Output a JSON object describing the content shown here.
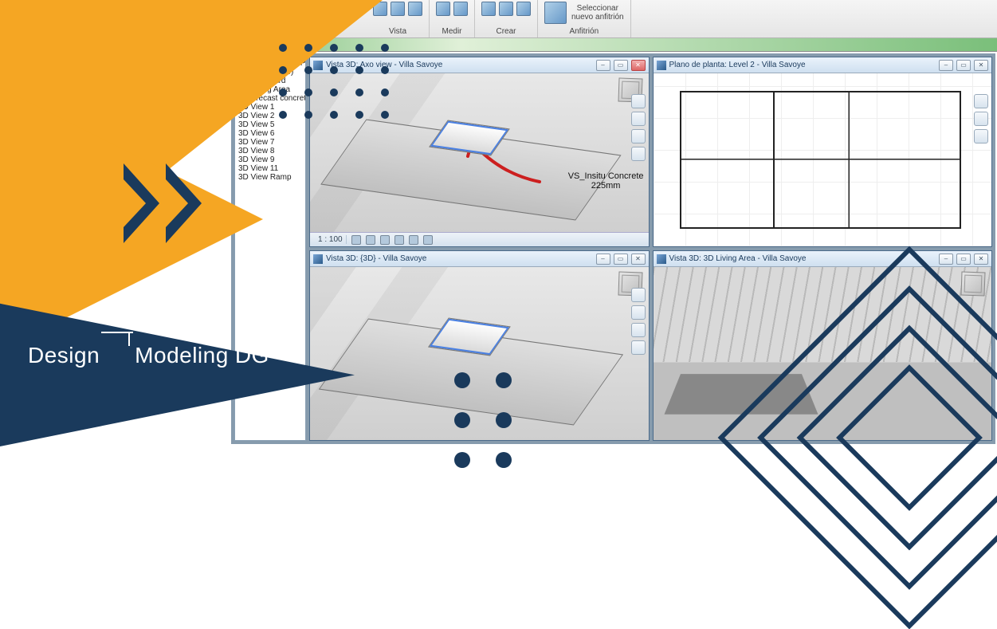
{
  "brand": {
    "logo_text_1": "Design",
    "logo_text_2": "Modeling",
    "logo_text_3": "DG"
  },
  "ribbon": {
    "panels": [
      {
        "label": "Vista"
      },
      {
        "label": "Medir"
      },
      {
        "label": "Crear"
      },
      {
        "label": "Anfitrión",
        "big_label": "Seleccionar\nnuevo anfitrión"
      }
    ]
  },
  "browser": {
    "items": [
      "de techo (Ceiling Plan)",
      "is 3D (3D View)",
      "3D Courtyard",
      "3D Living Area",
      "3D Precast concrete_navisv",
      "3D View 1",
      "3D View 2",
      "3D View 5",
      "3D View 6",
      "3D View 7",
      "3D View 8",
      "3D View 9",
      "3D View 11",
      "3D View Ramp"
    ]
  },
  "viewports": {
    "tl": {
      "title": "Vista 3D: Axo view - Villa Savoye",
      "scale": "1 : 100",
      "annotation": "VS_Insitu Concrete\n225mm"
    },
    "tr": {
      "title": "Plano de planta: Level 2 - Villa Savoye"
    },
    "bl": {
      "title": "Vista 3D: {3D} - Villa Savoye"
    },
    "br": {
      "title": "Vista 3D: 3D Living Area - Villa Savoye"
    }
  }
}
